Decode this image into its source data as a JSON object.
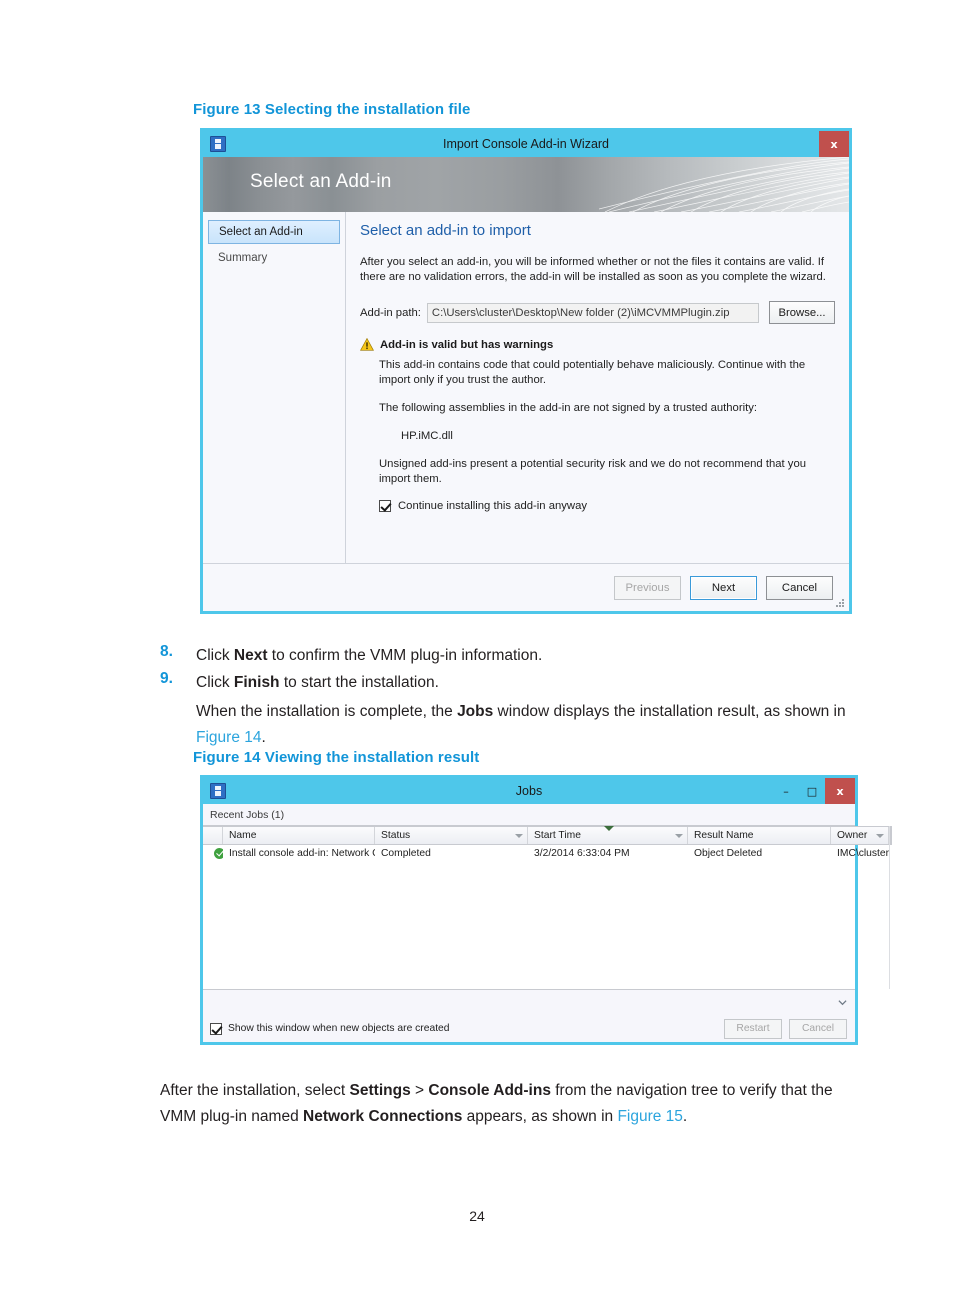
{
  "page": {
    "number": "24"
  },
  "figure13": {
    "caption": "Figure 13 Selecting the installation file",
    "window": {
      "title": "Import Console Add-in Wizard",
      "app_icon": "wizard-app-icon",
      "close_label": "x",
      "banner_title": "Select an Add-in",
      "nav": [
        {
          "label": "Select an Add-in",
          "active": true
        },
        {
          "label": "Summary",
          "active": false
        }
      ],
      "heading": "Select an add-in to import",
      "intro": "After you select an add-in, you will be informed whether or not the files it contains are valid. If there are no validation errors, the add-in will be installed as soon as you complete the wizard.",
      "path_label": "Add-in path:",
      "path_value": "C:\\Users\\cluster\\Desktop\\New folder (2)\\iMCVMMPlugin.zip",
      "browse_label": "Browse...",
      "warning_title": "Add-in is valid but has warnings",
      "warning_p1": "This add-in contains code that could potentially behave maliciously. Continue with the import only if you trust the author.",
      "warning_p2": "The following assemblies in the add-in are not signed by a trusted authority:",
      "assembly": "HP.iMC.dll",
      "warning_p3": "Unsigned add-ins present a potential security risk and we do not recommend that you import them.",
      "continue_checkbox_label": "Continue installing this add-in anyway",
      "continue_checked": true,
      "buttons": {
        "previous": "Previous",
        "next": "Next",
        "cancel": "Cancel"
      }
    }
  },
  "steps": [
    {
      "number": "8.",
      "parts": [
        {
          "t": "Click ",
          "b": false
        },
        {
          "t": "Next",
          "b": true
        },
        {
          "t": " to confirm the VMM plug-in information.",
          "b": false
        }
      ]
    },
    {
      "number": "9.",
      "parts": [
        {
          "t": "Click ",
          "b": false
        },
        {
          "t": "Finish",
          "b": true
        },
        {
          "t": " to start the installation.",
          "b": false
        }
      ]
    }
  ],
  "paragraph_jobs": {
    "p1": "When the installation is complete, the ",
    "b1": "Jobs",
    "p2": " window displays the installation result, as shown in ",
    "link": "Figure 14",
    "p3": "."
  },
  "figure14": {
    "caption": "Figure 14 Viewing the installation result",
    "window": {
      "title": "Jobs",
      "app_icon": "jobs-app-icon",
      "minimize_label": "–",
      "maximize_label": "□",
      "close_label": "x",
      "subbar_label": "Recent Jobs (1)",
      "search_value": "",
      "search_icon": "search-icon",
      "columns": [
        "Name",
        "Status",
        "Start Time",
        "Result Name",
        "Owner"
      ],
      "sorted_column": "Start Time",
      "rows": [
        {
          "status_icon": "success-icon",
          "name": "Install console add-in: Network Co...",
          "status": "Completed",
          "start_time": "3/2/2014 6:33:04 PM",
          "result_name": "Object Deleted",
          "owner": "IMC\\cluster"
        }
      ],
      "footer_checkbox_label": "Show this window when new objects are created",
      "footer_checked": true,
      "restart_label": "Restart",
      "cancel_label": "Cancel"
    }
  },
  "paragraph_after": {
    "p1": "After the installation, select ",
    "b1": "Settings",
    "p2": " > ",
    "b2": "Console Add-ins",
    "p3": " from the navigation tree to verify that the VMM plug-in named ",
    "b3": "Network Connections",
    "p4": " appears, as shown in ",
    "link": "Figure 15",
    "p5": "."
  },
  "colors": {
    "accent_blue": "#1295d8",
    "link_blue": "#2ba4dd",
    "frame_cyan": "#4ec7ea",
    "close_red": "#c0504d",
    "success_green": "#3fa13f"
  }
}
